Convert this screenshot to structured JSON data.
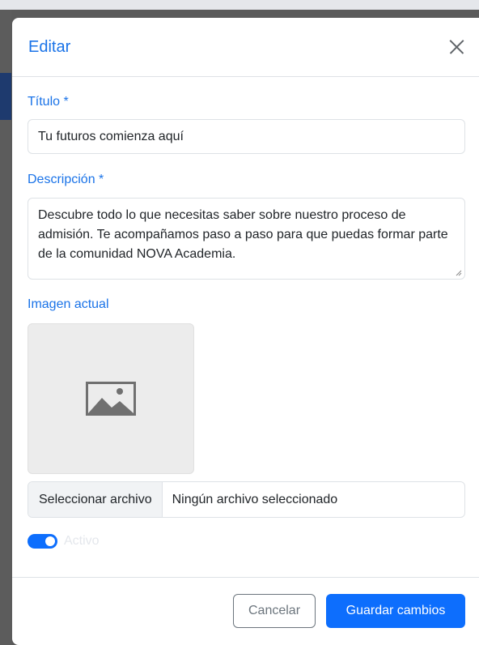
{
  "modal": {
    "title": "Editar",
    "fields": {
      "title_label": "Título *",
      "title_value": "Tu futuros comienza aquí",
      "description_label": "Descripción *",
      "description_value": "Descubre todo lo que necesitas saber sobre nuestro proceso de admisión. Te acompañamos paso a paso para que puedas formar parte de la comunidad NOVA Academia.",
      "image_label": "Imagen actual",
      "file_button": "Seleccionar archivo",
      "file_name": "Ningún archivo seleccionado",
      "active_label": "Activo",
      "active": true
    },
    "footer": {
      "cancel_label": "Cancelar",
      "save_label": "Guardar cambios"
    }
  },
  "colors": {
    "accent": "#1a73e8",
    "primary_button": "#0d6efd"
  }
}
